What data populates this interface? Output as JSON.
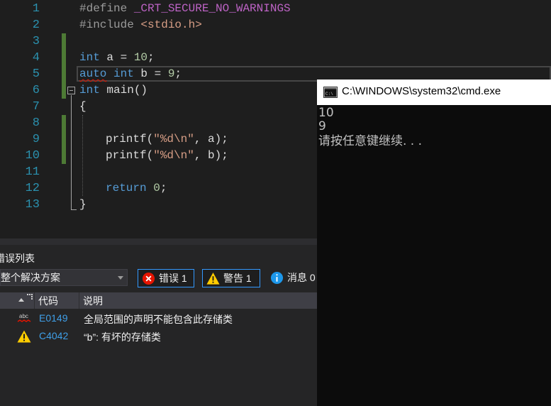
{
  "editor": {
    "line_numbers": [
      "1",
      "2",
      "3",
      "4",
      "5",
      "6",
      "7",
      "8",
      "9",
      "10",
      "11",
      "12",
      "13"
    ],
    "code": {
      "l1_directive": "#define ",
      "l1_macro": "_CRT_SECURE_NO_WARNINGS",
      "l2_directive": "#include ",
      "l2_header": "<stdio.h>",
      "l4_type": "int",
      "l4_rest": " a = ",
      "l4_value": "10",
      "l4_end": ";",
      "l5_auto": "auto",
      "l5_type": "int",
      "l5_rest": " b = ",
      "l5_value": "9",
      "l5_end": ";",
      "l6_type": "int",
      "l6_rest": " main()",
      "l7": "{",
      "l9_call": "printf(",
      "l9_fmt": "\"%d\\n\"",
      "l9_rest": ", a);",
      "l10_call": "printf(",
      "l10_fmt": "\"%d\\n\"",
      "l10_rest": ", b);",
      "l12_kw": "return",
      "l12_value": "0",
      "l12_end": ";",
      "l13": "}"
    }
  },
  "error_list": {
    "title": "错误列表",
    "scope": "整个解决方案",
    "errors_button": "错误 1",
    "warnings_button": "警告 1",
    "messages_button": "消息 0",
    "columns": {
      "code": "代码",
      "description": "说明"
    },
    "rows": [
      {
        "icon": "abc-squiggle-icon",
        "code": "E0149",
        "description": "全局范围的声明不能包含此存储类"
      },
      {
        "icon": "warning-icon",
        "code": "C4042",
        "description": "“b”: 有坏的存储类"
      }
    ]
  },
  "console": {
    "title": "C:\\WINDOWS\\system32\\cmd.exe",
    "lines": [
      "10",
      "9",
      "请按任意键继续. . ."
    ]
  },
  "colors": {
    "editor_bg": "#1e1e1e",
    "line_number": "#2b91af",
    "keyword": "#569cd6",
    "macro": "#bd63c5",
    "string": "#d69d85",
    "number": "#b5cea8",
    "change_marker": "#4d7a35",
    "error_red": "#e51400",
    "link_blue": "#3f9fe8"
  }
}
